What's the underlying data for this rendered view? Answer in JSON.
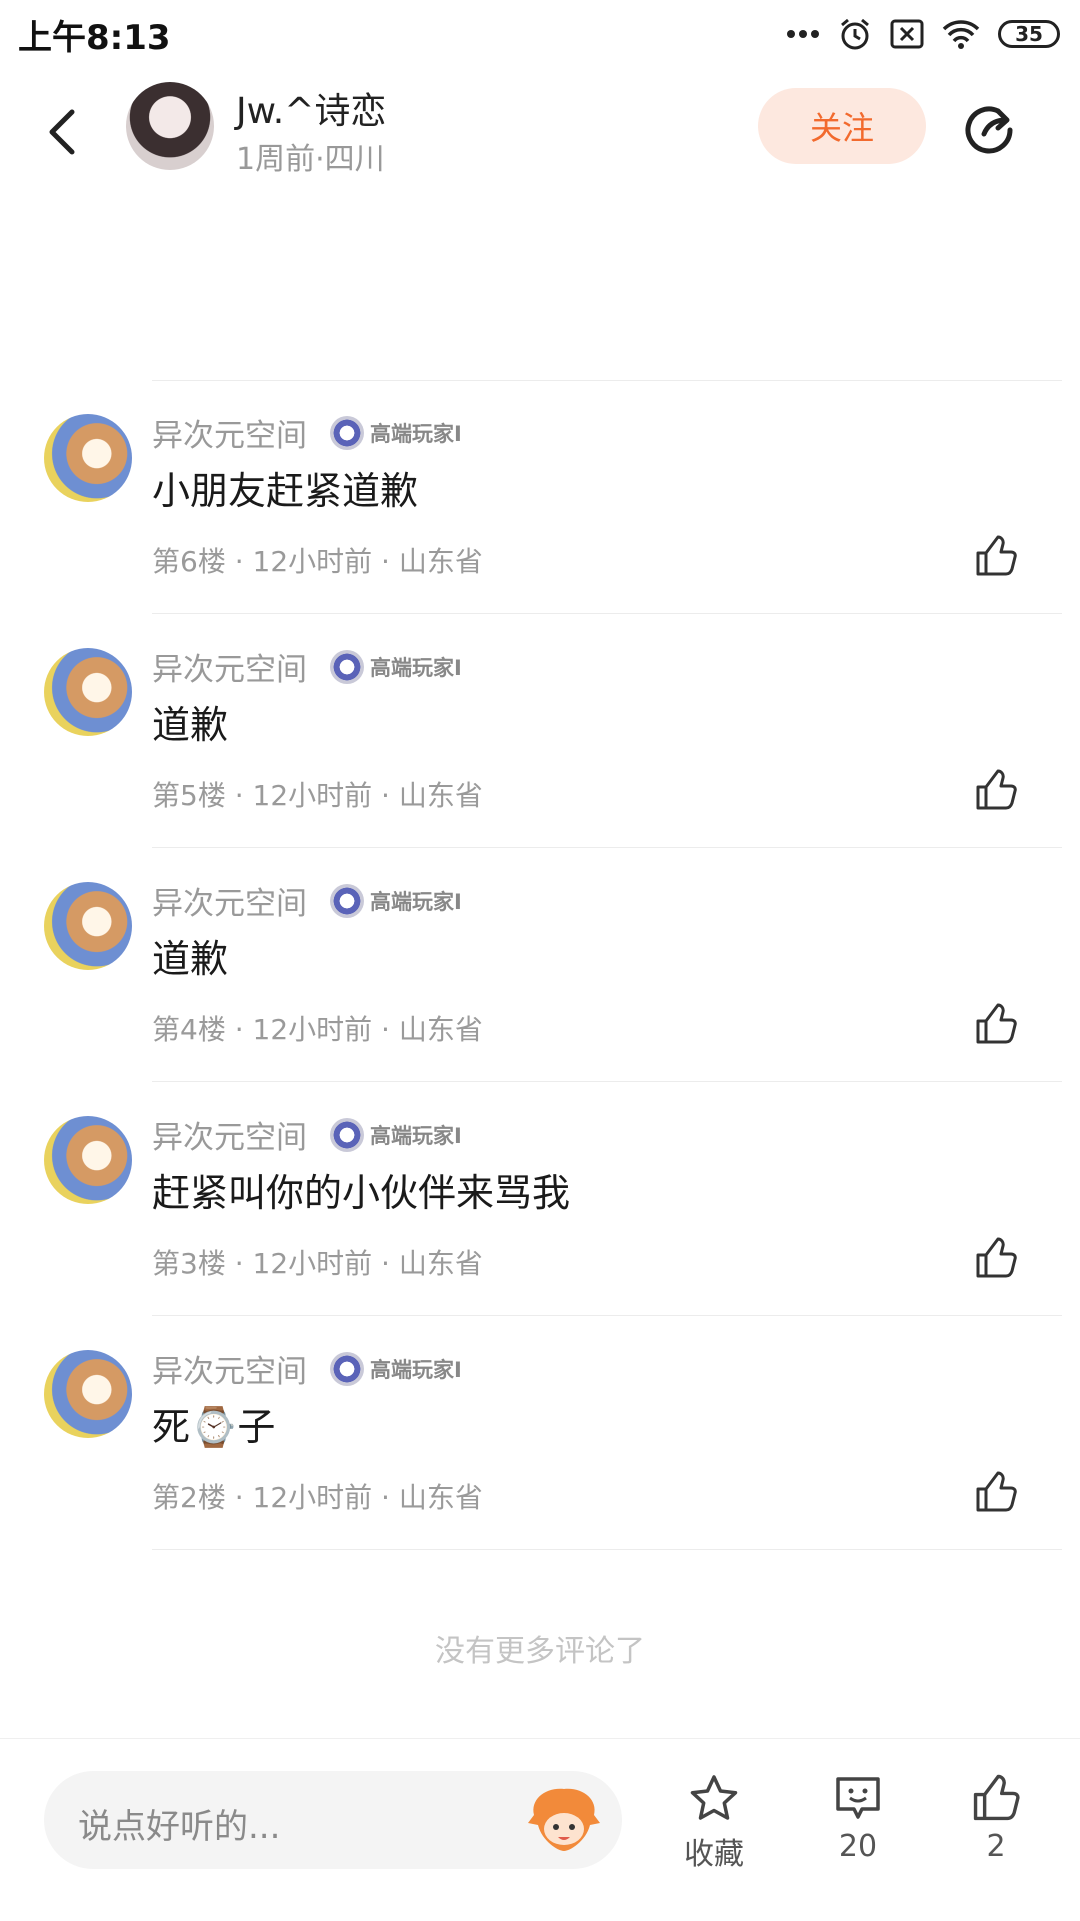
{
  "status_bar": {
    "time": "上午8:13",
    "battery": "35"
  },
  "header": {
    "author_name": "Jw.^诗恋",
    "author_meta": "1周前·四川",
    "follow_label": "关注"
  },
  "comments": [
    {
      "user": "异次元空间",
      "badge": "高端玩家I",
      "text": "小朋友赶紧道歉",
      "meta": "第6楼 · 12小时前 · 山东省"
    },
    {
      "user": "异次元空间",
      "badge": "高端玩家I",
      "text": "道歉",
      "meta": "第5楼 · 12小时前 · 山东省"
    },
    {
      "user": "异次元空间",
      "badge": "高端玩家I",
      "text": "道歉",
      "meta": "第4楼 · 12小时前 · 山东省"
    },
    {
      "user": "异次元空间",
      "badge": "高端玩家I",
      "text": "赶紧叫你的小伙伴来骂我",
      "meta": "第3楼 · 12小时前 · 山东省"
    },
    {
      "user": "异次元空间",
      "badge": "高端玩家I",
      "text": "死⌚子",
      "meta": "第2楼 · 12小时前 · 山东省"
    }
  ],
  "no_more_text": "没有更多评论了",
  "bottom_bar": {
    "input_placeholder": "说点好听的...",
    "favorite_label": "收藏",
    "comment_count": "20",
    "like_count": "2"
  }
}
